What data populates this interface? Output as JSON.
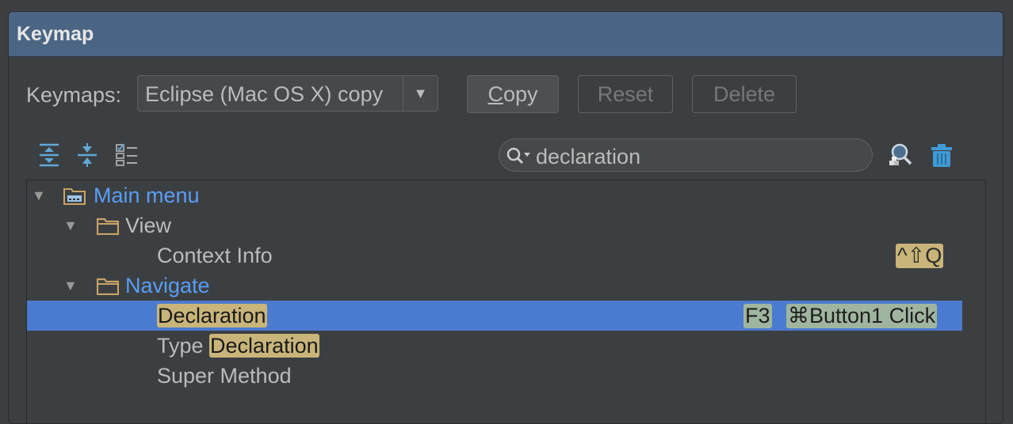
{
  "dialog": {
    "title": "Keymap"
  },
  "keymaps": {
    "label": "Keymaps:",
    "selected": "Eclipse (Mac OS X) copy",
    "dropdown_arrow": "▼"
  },
  "buttons": {
    "copy_underlined": "C",
    "copy_rest": "opy",
    "reset": "Reset",
    "delete": "Delete"
  },
  "toolbar": {
    "icons": [
      "expand-all-icon",
      "collapse-all-icon",
      "edit-keymap-icon"
    ]
  },
  "search": {
    "value": "declaration",
    "icon": "search-icon"
  },
  "actions": {
    "find_by_shortcut_icon": "find-by-shortcut-icon",
    "clear_filter_icon": "trash-icon"
  },
  "tree": {
    "main_menu": {
      "label": "Main menu",
      "expanded": true
    },
    "view": {
      "label": "View",
      "expanded": true
    },
    "context_info": {
      "label": "Context Info",
      "shortcut": "^⇧Q"
    },
    "navigate": {
      "label": "Navigate",
      "expanded": true
    },
    "declaration": {
      "label": "Declaration",
      "shortcut1": "F3",
      "shortcut2": "⌘Button1 Click",
      "selected": true
    },
    "type_declaration": {
      "prefix": "Type ",
      "match": "Declaration"
    },
    "super_method": {
      "label": "Super Method"
    }
  },
  "colors": {
    "background": "#3c3f41",
    "title_bar": "#4b6584",
    "selection": "#4b7bd0",
    "highlight": "#c9b57a",
    "link_blue": "#589df6"
  }
}
